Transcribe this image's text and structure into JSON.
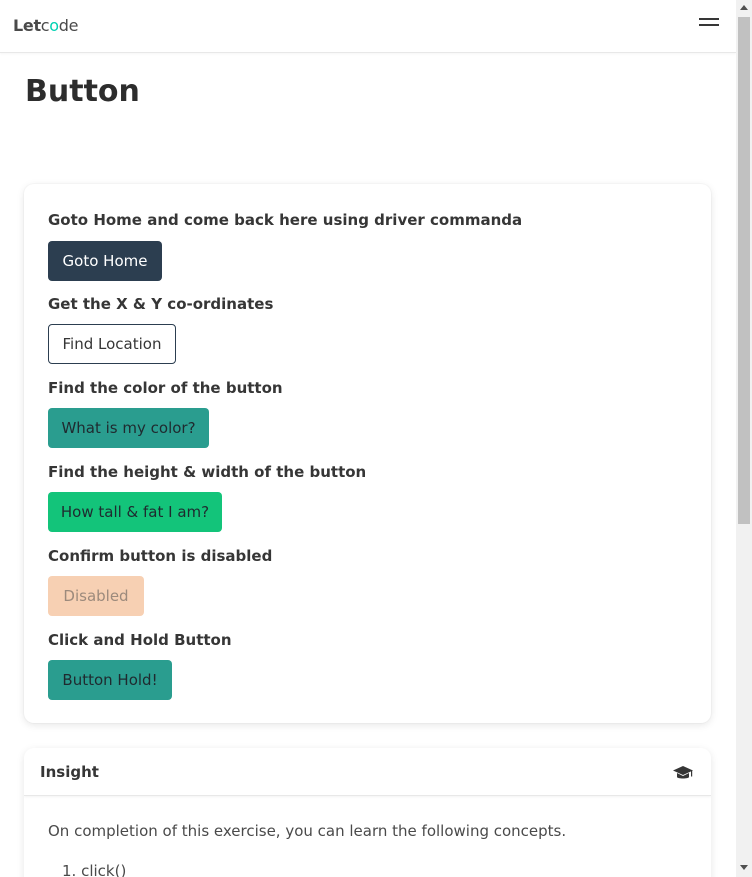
{
  "navbar": {
    "logo": {
      "part1": "Let",
      "part2": "c",
      "part3": "o",
      "part4": "de"
    },
    "menu_icon": "hamburger-icon"
  },
  "page": {
    "title": "Button"
  },
  "buttons_card": {
    "rows": [
      {
        "label": "Goto Home and come back here using driver commanda",
        "button": "Goto Home"
      },
      {
        "label": "Get the X & Y co-ordinates",
        "button": "Find Location"
      },
      {
        "label": "Find the color of the button",
        "button": "What is my color?"
      },
      {
        "label": "Find the height & width of the button",
        "button": "How tall & fat I am?"
      },
      {
        "label": "Confirm button is disabled",
        "button": "Disabled"
      },
      {
        "label": "Click and Hold Button",
        "button": "Button Hold!"
      }
    ]
  },
  "insight": {
    "title": "Insight",
    "icon": "graduation-cap-icon",
    "description": "On completion of this exercise, you can learn the following concepts.",
    "concepts": [
      "1. click()"
    ]
  },
  "colors": {
    "dark_button": "#2c3e50",
    "teal_button": "#2a9d8f",
    "green_button": "#13c47a",
    "disabled_button": "#f7d0b3"
  }
}
